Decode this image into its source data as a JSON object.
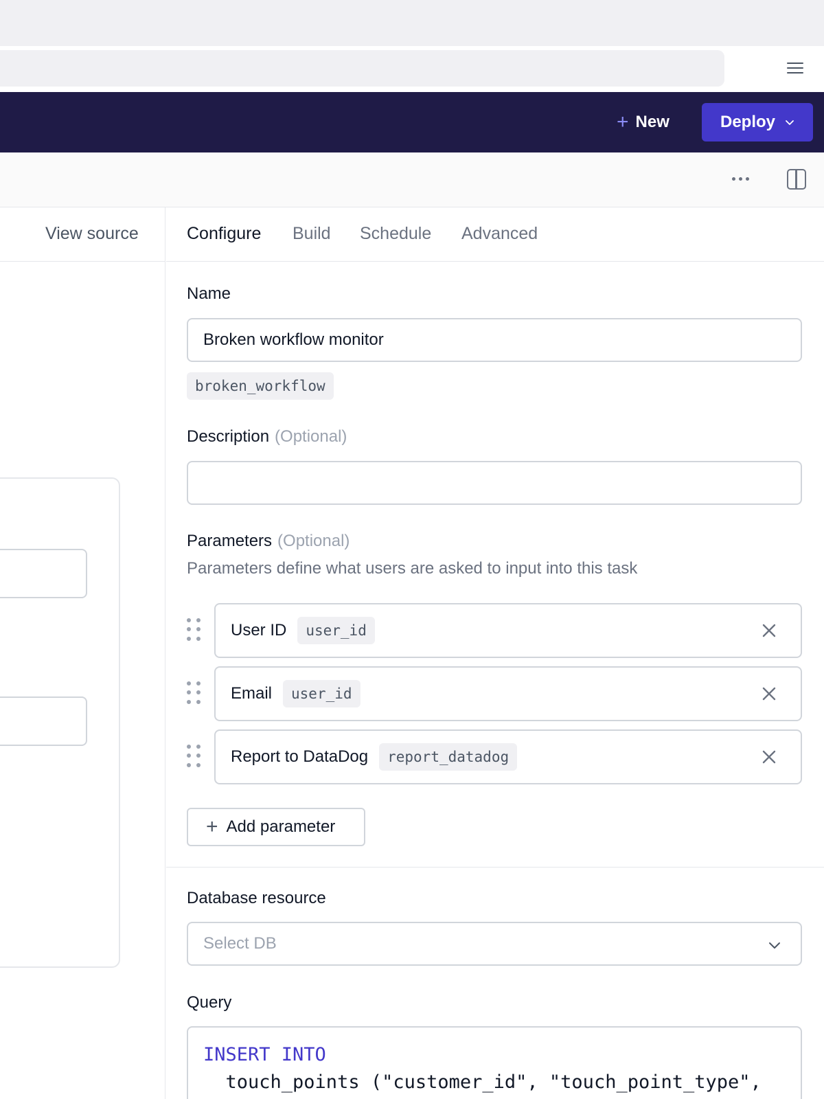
{
  "header": {
    "new_label": "New",
    "deploy_label": "Deploy"
  },
  "left": {
    "view_source_label": "View source"
  },
  "tabs": [
    {
      "label": "Configure",
      "active": true
    },
    {
      "label": "Build",
      "active": false
    },
    {
      "label": "Schedule",
      "active": false
    },
    {
      "label": "Advanced",
      "active": false
    }
  ],
  "form": {
    "name": {
      "label": "Name",
      "value": "Broken workflow monitor",
      "slug": "broken_workflow"
    },
    "description": {
      "label": "Description",
      "optional": "(Optional)",
      "value": ""
    },
    "parameters": {
      "label": "Parameters",
      "optional": "(Optional)",
      "helper": "Parameters define what users are asked to input into this task",
      "items": [
        {
          "name": "User ID",
          "key": "user_id"
        },
        {
          "name": "Email",
          "key": "user_id"
        },
        {
          "name": "Report to DataDog",
          "key": "report_datadog"
        }
      ],
      "add_label": "Add parameter"
    },
    "database": {
      "label": "Database resource",
      "placeholder": "Select DB"
    },
    "query": {
      "label": "Query",
      "keyword_line": "INSERT INTO",
      "line2": "  touch_points (\"customer_id\", \"touch_point_type\","
    }
  },
  "colors": {
    "header_bg": "#1f1b47",
    "accent": "#4338ca"
  }
}
